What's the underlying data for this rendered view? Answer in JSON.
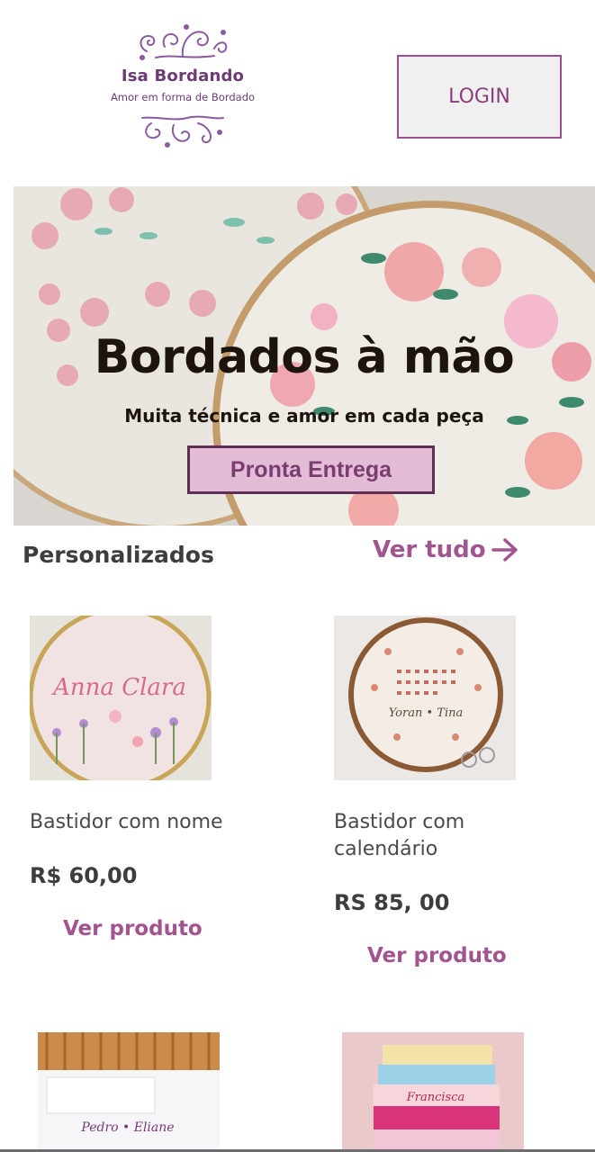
{
  "header": {
    "logo_name": "Isa Bordando",
    "logo_tagline": "Amor em forma de Bordado",
    "login_label": "LOGIN"
  },
  "hero": {
    "title": "Bordados à mão",
    "subtitle": "Muita técnica e amor em cada peça",
    "button_label": "Pronta Entrega"
  },
  "section": {
    "title": "Personalizados",
    "see_all_label": "Ver tudo"
  },
  "products": [
    {
      "name": "Bastidor com nome",
      "price": "R$ 60,00",
      "view_label": "Ver produto",
      "embroidery_text": "Anna Clara"
    },
    {
      "name": "Bastidor com calendário",
      "price": "RS 85, 00",
      "view_label": "Ver produto",
      "embroidery_text": "Yoran • Tina"
    }
  ],
  "more_products": [
    {
      "embroidery_text": "Pedro • Eliane"
    },
    {
      "embroidery_text": "Francisca"
    }
  ],
  "colors": {
    "brand_purple": "#6b3b73",
    "accent_pink": "#a2548f",
    "button_pink": "#e3bcd6"
  },
  "icons": {
    "arrow": "arrow-right-icon",
    "logo_ornament": "swirl-ornament-icon"
  }
}
